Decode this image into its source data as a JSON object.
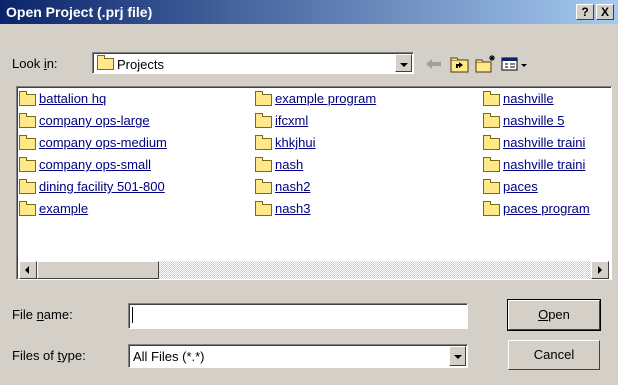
{
  "title": "Open Project (.prj file)",
  "titlebar_buttons": {
    "help": "?",
    "close": "X"
  },
  "look_in": {
    "label_pre": "Look ",
    "label_key": "i",
    "label_post": "n:",
    "value": "Projects"
  },
  "toolbar": [
    "back-arrow-icon",
    "up-folder-icon",
    "new-folder-icon",
    "view-menu-icon"
  ],
  "files": {
    "col1": [
      "battalion hq",
      "company ops-large",
      "company ops-medium",
      "company ops-small",
      "dining facility 501-800",
      "example"
    ],
    "col2": [
      "example program",
      "ifcxml",
      "khkjhui",
      "nash",
      "nash2",
      "nash3"
    ],
    "col3": [
      "nashville",
      "nashville 5",
      "nashville traini",
      "nashville traini",
      "paces",
      "paces program"
    ]
  },
  "file_name": {
    "label_pre": "File ",
    "label_key": "n",
    "label_post": "ame:",
    "value": ""
  },
  "files_of_type": {
    "label_pre": "Files of ",
    "label_key": "t",
    "label_post": "ype:",
    "value": "All Files (*.*)"
  },
  "buttons": {
    "open_key": "O",
    "open_rest": "pen",
    "cancel": "Cancel"
  },
  "colors": {
    "title_start": "#0a246a",
    "title_end": "#a6caf0",
    "face": "#d4d0c8"
  }
}
